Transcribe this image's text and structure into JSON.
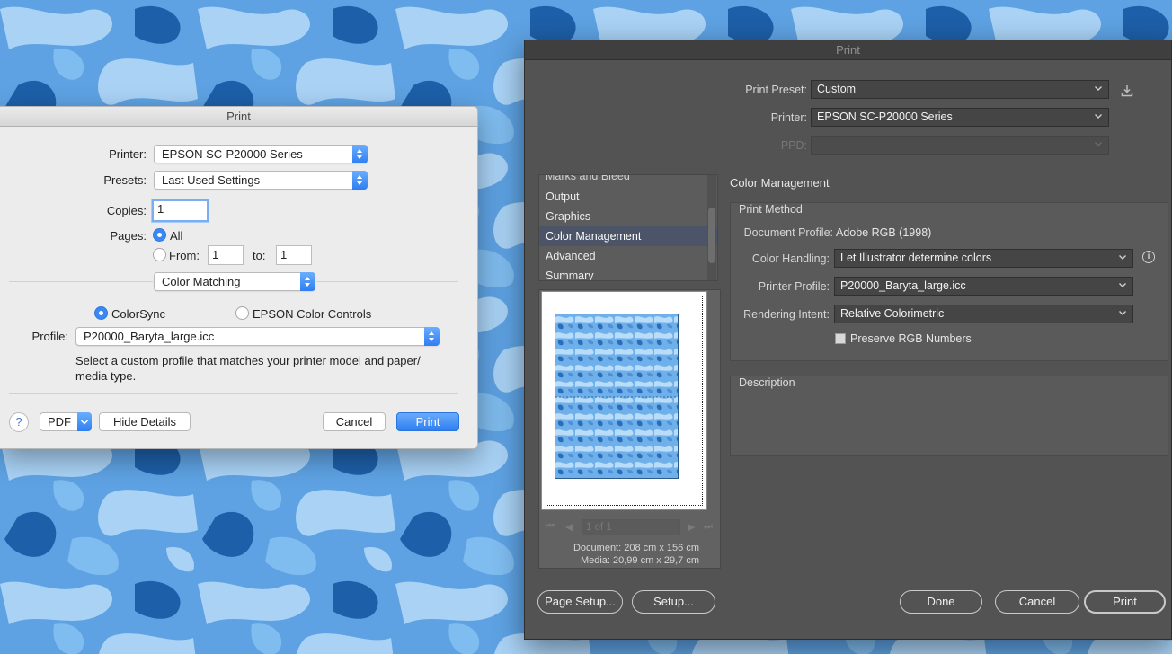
{
  "mac_print": {
    "title": "Print",
    "printer_label": "Printer:",
    "printer_value": "EPSON SC-P20000 Series",
    "presets_label": "Presets:",
    "presets_value": "Last Used Settings",
    "copies_label": "Copies:",
    "copies_value": "1",
    "pages_label": "Pages:",
    "pages_all": "All",
    "pages_from_label": "From:",
    "pages_from_value": "1",
    "pages_to_label": "to:",
    "pages_to_value": "1",
    "section_value": "Color Matching",
    "colorsync_label": "ColorSync",
    "epson_label": "EPSON Color Controls",
    "profile_label": "Profile:",
    "profile_value": "P20000_Baryta_large.icc",
    "hint": "Select a custom profile that matches your printer model and paper/ media type.",
    "help_label": "?",
    "pdf_label": "PDF",
    "hide_details_label": "Hide Details",
    "cancel_label": "Cancel",
    "print_label": "Print"
  },
  "ai_print": {
    "title": "Print",
    "preset_label": "Print Preset:",
    "preset_value": "Custom",
    "printer_label": "Printer:",
    "printer_value": "EPSON SC-P20000 Series",
    "ppd_label": "PPD:",
    "ppd_value": "",
    "sidebar_items": [
      "Marks and Bleed",
      "Output",
      "Graphics",
      "Color Management",
      "Advanced",
      "Summary"
    ],
    "selected_item": "Color Management",
    "pager_text": "1 of 1",
    "document_size": "Document: 208 cm x 156 cm",
    "media_size": "Media: 20,99 cm x 29,7 cm",
    "section_title": "Color Management",
    "print_method_title": "Print Method",
    "document_profile_label": "Document Profile:",
    "document_profile_value": "Adobe RGB (1998)",
    "color_handling_label": "Color Handling:",
    "color_handling_value": "Let Illustrator determine colors",
    "printer_profile_label": "Printer Profile:",
    "printer_profile_value": "P20000_Baryta_large.icc",
    "rendering_intent_label": "Rendering Intent:",
    "rendering_intent_value": "Relative Colorimetric",
    "preserve_rgb_label": "Preserve RGB Numbers",
    "description_title": "Description",
    "page_setup_label": "Page Setup...",
    "setup_label": "Setup...",
    "done_label": "Done",
    "cancel_label": "Cancel",
    "print_label": "Print"
  },
  "colors": {
    "camo_base": "#5ea2e3",
    "camo_light": "#a9d2f5",
    "camo_dark": "#1d5fa8",
    "accent_blue": "#2e7ef2",
    "ai_panel": "#535353"
  }
}
